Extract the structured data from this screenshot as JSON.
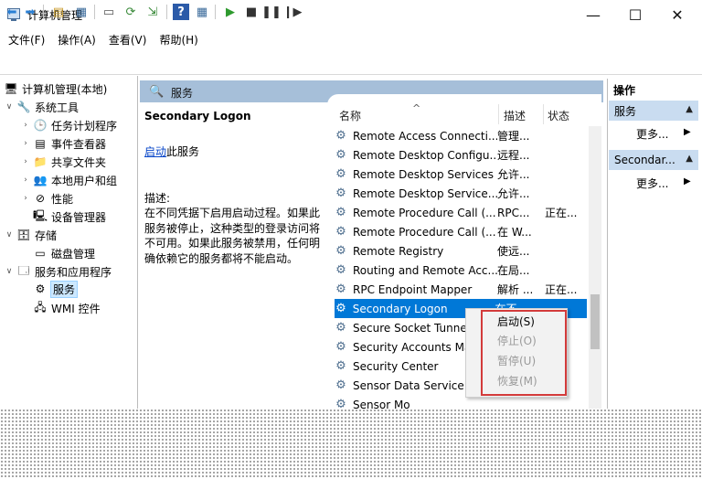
{
  "window": {
    "title": "计算机管理"
  },
  "window_controls": {
    "minimize": "—",
    "maximize": "☐",
    "close": "✕"
  },
  "menu": [
    "文件(F)",
    "操作(A)",
    "查看(V)",
    "帮助(H)"
  ],
  "tree": {
    "root": "计算机管理(本地)",
    "system_tools": "系统工具",
    "task_scheduler": "任务计划程序",
    "event_viewer": "事件查看器",
    "shared_folders": "共享文件夹",
    "local_users": "本地用户和组",
    "performance": "性能",
    "device_manager": "设备管理器",
    "storage": "存储",
    "disk_management": "磁盘管理",
    "services_apps": "服务和应用程序",
    "services": "服务",
    "wmi": "WMI 控件"
  },
  "middle": {
    "header_title": "服务",
    "service_name": "Secondary Logon",
    "start_link": "启动",
    "start_link_suffix": "此服务",
    "desc_label": "描述:",
    "desc_text": "在不同凭据下启用启动过程。如果此服务被停止，这种类型的登录访问将不可用。如果此服务被禁用，任何明确依赖它的服务都将不能启动。"
  },
  "columns": {
    "name": "名称",
    "desc": "描述",
    "status": "状态"
  },
  "services": [
    {
      "name": "Remote Access Connecti...",
      "desc": "管理...",
      "status": ""
    },
    {
      "name": "Remote Desktop Configu...",
      "desc": "远程...",
      "status": ""
    },
    {
      "name": "Remote Desktop Services",
      "desc": "允许...",
      "status": ""
    },
    {
      "name": "Remote Desktop Service...",
      "desc": "允许...",
      "status": ""
    },
    {
      "name": "Remote Procedure Call (...",
      "desc": "RPC...",
      "status": "正在..."
    },
    {
      "name": "Remote Procedure Call (...",
      "desc": "在 W...",
      "status": ""
    },
    {
      "name": "Remote Registry",
      "desc": "使远...",
      "status": ""
    },
    {
      "name": "Routing and Remote Acc...",
      "desc": "在局...",
      "status": ""
    },
    {
      "name": "RPC Endpoint Mapper",
      "desc": "解析 ...",
      "status": "正在..."
    },
    {
      "name": "Secondary Logon",
      "desc": "在不...",
      "status": ""
    },
    {
      "name": "Secure Socket Tunne",
      "desc": "",
      "status": ""
    },
    {
      "name": "Security Accounts Ma",
      "desc": "",
      "status": ""
    },
    {
      "name": "Security Center",
      "desc": "",
      "status": ""
    },
    {
      "name": "Sensor Data Service",
      "desc": "",
      "status": ""
    },
    {
      "name": "Sensor Mo",
      "desc": "",
      "status": ""
    }
  ],
  "context_menu": {
    "start": "启动(S)",
    "stop": "停止(O)",
    "pause": "暂停(U)",
    "resume": "恢复(M)"
  },
  "actions": {
    "title": "操作",
    "section1": "服务",
    "more1": "更多...",
    "section2": "Secondar...",
    "more2": "更多..."
  },
  "colors": {
    "selection": "#0078d7",
    "header": "#a6bfd9",
    "action_section": "#c9dcf0",
    "highlight_box": "#d33b3b"
  }
}
